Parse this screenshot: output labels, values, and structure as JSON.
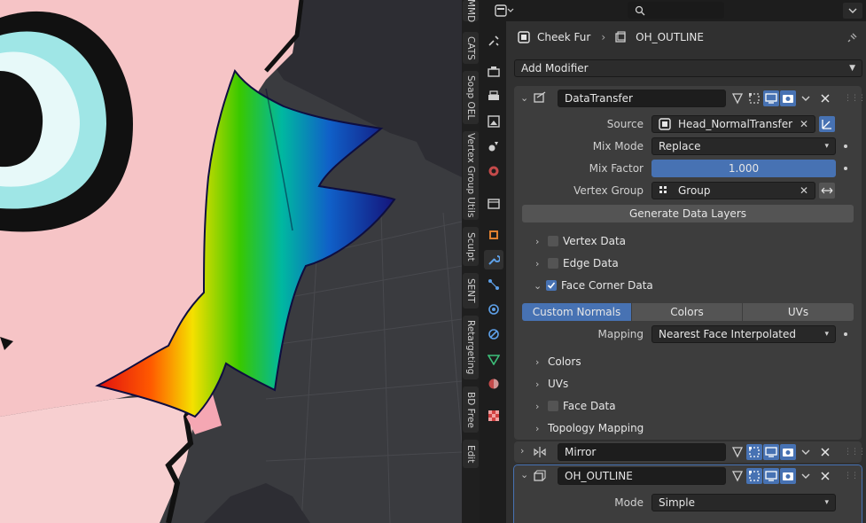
{
  "ntabs": [
    "MMD",
    "CATS",
    "Soap OEL",
    "Vertex Group Utils",
    "Sculpt",
    "SENT",
    "Retargeting",
    "BD Free",
    "Edit"
  ],
  "breadcrumb": {
    "object": "Cheek Fur",
    "modifier": "OH_OUTLINE"
  },
  "add_modifier": "Add Modifier",
  "datatransfer": {
    "name": "DataTransfer",
    "source_label": "Source",
    "source_value": "Head_NormalTransfer",
    "mix_mode_label": "Mix Mode",
    "mix_mode_value": "Replace",
    "mix_factor_label": "Mix Factor",
    "mix_factor_value": "1.000",
    "mix_factor_fraction": 1.0,
    "vertex_group_label": "Vertex Group",
    "vertex_group_value": "Group",
    "generate_button": "Generate Data Layers",
    "vertex_data": "Vertex Data",
    "edge_data": "Edge Data",
    "face_corner_data": "Face Corner Data",
    "tabs": [
      "Custom Normals",
      "Colors",
      "UVs"
    ],
    "mapping_label": "Mapping",
    "mapping_value": "Nearest Face Interpolated",
    "colors": "Colors",
    "uvs": "UVs",
    "face_data": "Face Data",
    "topology_mapping": "Topology Mapping"
  },
  "mirror": {
    "name": "Mirror"
  },
  "outline": {
    "name": "OH_OUTLINE",
    "mode_label": "Mode",
    "mode_value": "Simple"
  },
  "colors": {
    "accent": "#4772b3",
    "panel": "#3d3d3d",
    "bg": "#303030"
  }
}
